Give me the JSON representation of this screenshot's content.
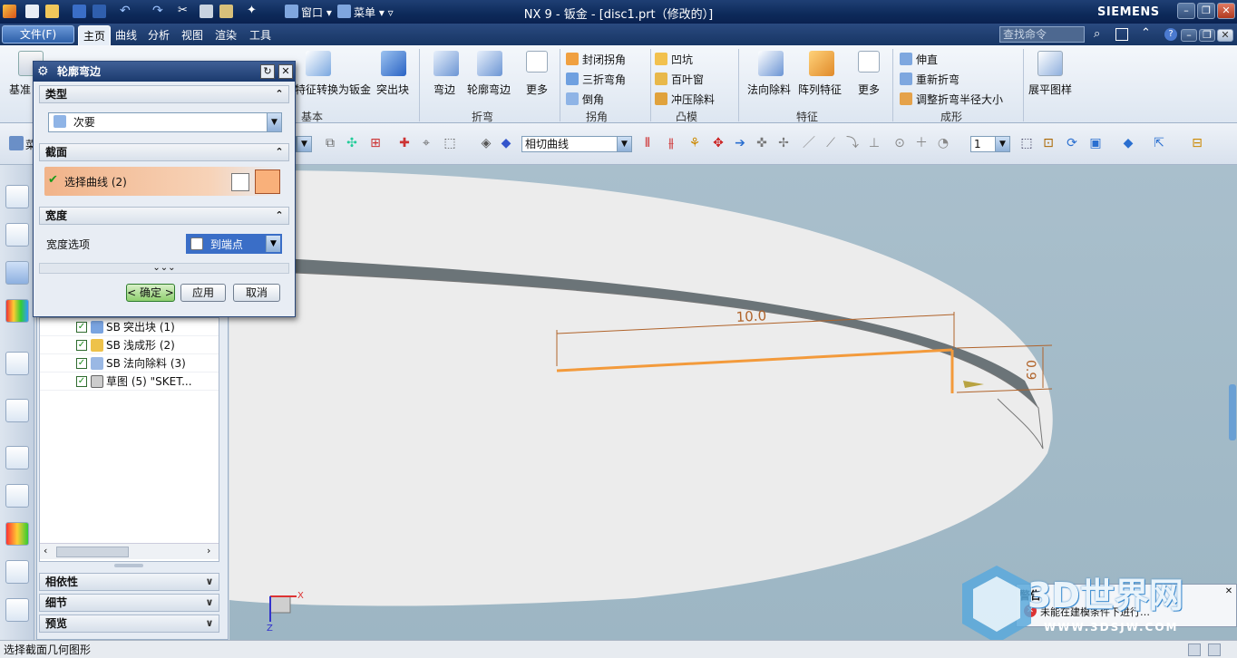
{
  "app": {
    "title": "NX 9 - 钣金 - [disc1.prt（修改的）]",
    "brand": "SIEMENS"
  },
  "menubar": {
    "file": "文件(F)",
    "tabs": [
      "主页",
      "曲线",
      "分析",
      "视图",
      "渲染",
      "工具"
    ],
    "search_placeholder": "查找命令"
  },
  "ribbon": {
    "basic": {
      "partial": "基准",
      "convert": "特征转换为钣金",
      "tab": "突出块",
      "group": "基本"
    },
    "bend": {
      "flange": "弯边",
      "contour": "轮廓弯边",
      "more": "更多",
      "group": "折弯"
    },
    "corner": {
      "items": [
        "封闭拐角",
        "三折弯角",
        "倒角"
      ],
      "group": "拐角"
    },
    "emboss": {
      "items": [
        "凹坑",
        "百叶窗",
        "冲压除料"
      ],
      "group": "凸模"
    },
    "feature": {
      "normal_cut": "法向除料",
      "pattern": "阵列特征",
      "more": "更多",
      "group": "特征"
    },
    "form": {
      "items": [
        "伸直",
        "重新折弯",
        "调整折弯半径大小"
      ],
      "group": "成形"
    },
    "flat": {
      "flat_pattern": "展平图样"
    }
  },
  "toolbar": {
    "menu_partial": "菜",
    "curve_rule": "相切曲线",
    "layer": "1"
  },
  "dialog": {
    "title": "轮廓弯边",
    "type_section": "类型",
    "type_value": "次要",
    "section_section": "截面",
    "select_curve": "选择曲线 (2)",
    "width_section": "宽度",
    "width_option_label": "宽度选项",
    "width_option_value": "到端点",
    "ok": "< 确定 >",
    "apply": "应用",
    "cancel": "取消"
  },
  "navigator": {
    "rows": [
      {
        "prefix": "SB",
        "label": "突出块 (1)"
      },
      {
        "prefix": "SB",
        "label": "浅成形 (2)"
      },
      {
        "prefix": "SB",
        "label": "法向除料 (3)"
      },
      {
        "prefix": "",
        "label": "草图 (5) \"SKET..."
      }
    ],
    "panels": [
      "相依性",
      "细节",
      "预览"
    ]
  },
  "graphics": {
    "dim_length": "10.0",
    "dim_height": "0.9",
    "axis_x": "X",
    "axis_z": "Z",
    "warning": "警告",
    "warning_text": "未能在建模条件下进行…"
  },
  "watermark": {
    "name": "3D世界网",
    "url": "WWW.3DSJW.COM"
  },
  "status": {
    "text": "选择截面几何图形"
  }
}
